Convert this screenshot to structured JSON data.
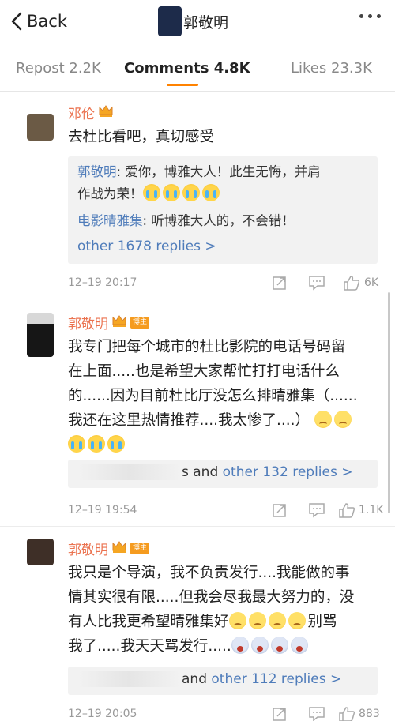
{
  "nav": {
    "back_label": "Back",
    "title": "郭敬明"
  },
  "tabs": [
    {
      "label": "Repost 2.2K",
      "active": false
    },
    {
      "label": "Comments 4.8K",
      "active": true
    },
    {
      "label": "Likes 23.3K",
      "active": false
    }
  ],
  "accent_color": "#ff8200",
  "comments": [
    {
      "username": "邓伦",
      "text": "去杜比看吧，真切感受",
      "replies": [
        {
          "name": "郭敬明",
          "text": ": 爱你，博雅大人！此生无悔，并肩",
          "text2": "作战为荣！"
        },
        {
          "name": "电影晴雅集",
          "text": ": 听博雅大人的，不会错！"
        }
      ],
      "more_replies": "other 1678 replies >",
      "time": "12–19 20:17",
      "likes": "6K"
    },
    {
      "username": "郭敬明",
      "badge": "博主",
      "lines": [
        "我专门把每个城市的杜比影院的电话号码留",
        "在上面.....也是希望大家帮忙打打电话什么",
        "的......因为目前杜比厅没怎么排晴雅集（......",
        "我还在这里热情推荐....我太惨了....）"
      ],
      "more_replies_prefix": "s and ",
      "more_replies": "other 132 replies >",
      "time": "12–19 19:54",
      "likes": "1.1K"
    },
    {
      "username": "郭敬明",
      "badge": "博主",
      "lines": [
        "我只是个导演，我不负责发行....我能做的事",
        "情其实很有限.....但我会尽我最大努力的，没",
        "有人比我更希望晴雅集好",
        "别骂",
        "我了.....我天天骂发行....."
      ],
      "more_replies_prefix": "and ",
      "more_replies": "other 112 replies >",
      "time": "12–19 20:05",
      "likes": "883"
    }
  ]
}
